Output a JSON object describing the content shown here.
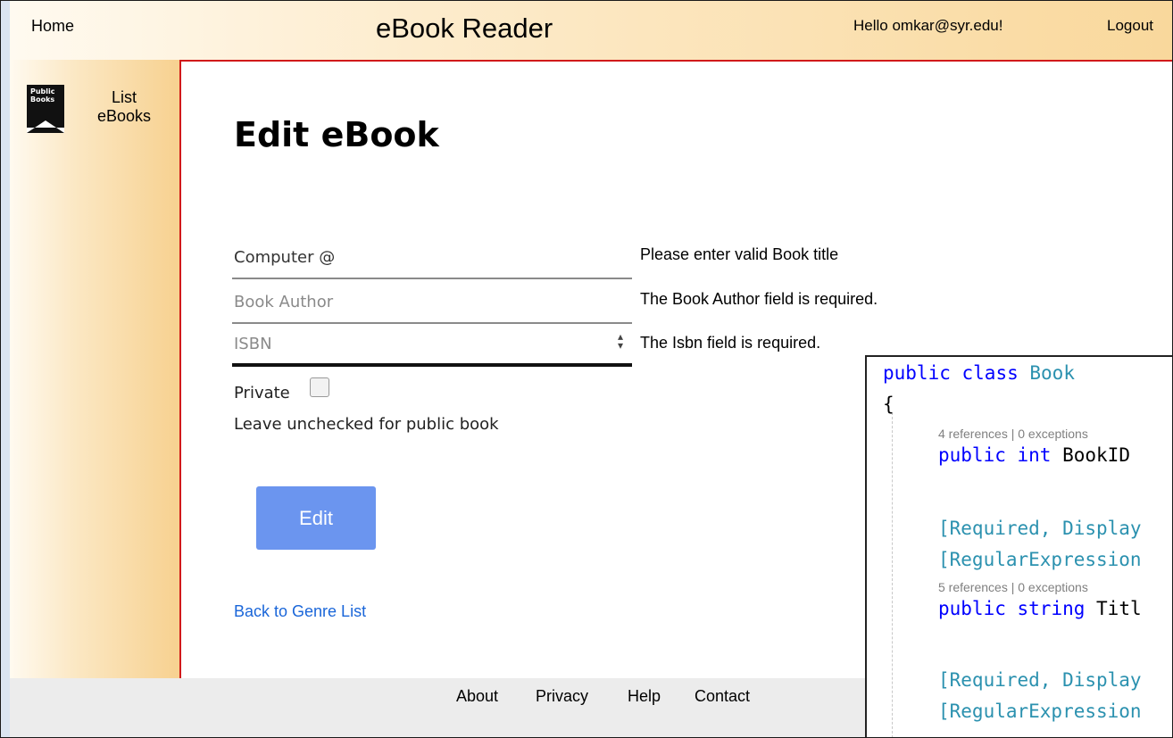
{
  "header": {
    "home": "Home",
    "title": "eBook Reader",
    "greeting": "Hello omkar@syr.edu!",
    "logout": "Logout"
  },
  "sidebar": {
    "logo_text": "Public Books",
    "list_line1": "List",
    "list_line2": "eBooks"
  },
  "page": {
    "title": "Edit eBook",
    "fields": {
      "title_value": "Computer @",
      "author_placeholder": "Book Author",
      "isbn_placeholder": "ISBN"
    },
    "errors": {
      "title": "Please enter valid Book title",
      "author": "The Book Author field is required.",
      "isbn": "The Isbn field is required."
    },
    "private_label": "Private",
    "private_checked": false,
    "hint": "Leave unchecked for public book",
    "edit_button": "Edit",
    "back_link": "Back to Genre List"
  },
  "footer": {
    "about": "About",
    "privacy": "Privacy",
    "help": "Help",
    "contact": "Contact"
  },
  "code_overlay": {
    "lines": {
      "class_kw1": "public",
      "class_kw2": "class",
      "class_name": "Book",
      "brace": "{",
      "lens1": "4 references | 0 exceptions",
      "bookid_kw1": "public",
      "bookid_kw2": "int",
      "bookid_name": "BookID",
      "attr1": "[Required, Display",
      "attr2": "[RegularExpression",
      "lens2": "5 references | 0 exceptions",
      "title_kw1": "public",
      "title_kw2": "string",
      "title_name": "Titl",
      "attr3": "[Required, Display",
      "attr4": "[RegularExpression"
    },
    "colors": {
      "keyword": "#0000ff",
      "type": "#2b91af",
      "lens": "#808080"
    }
  }
}
